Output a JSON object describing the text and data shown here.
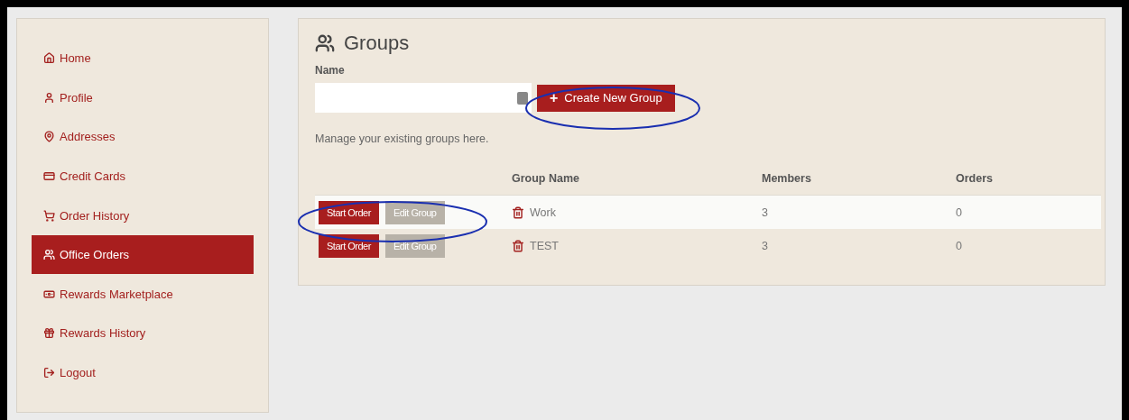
{
  "sidebar": {
    "items": [
      {
        "label": "Home",
        "selected": false
      },
      {
        "label": "Profile",
        "selected": false
      },
      {
        "label": "Addresses",
        "selected": false
      },
      {
        "label": "Credit Cards",
        "selected": false
      },
      {
        "label": "Order History",
        "selected": false
      },
      {
        "label": "Office Orders",
        "selected": true
      },
      {
        "label": "Rewards Marketplace",
        "selected": false
      },
      {
        "label": "Rewards History",
        "selected": false
      },
      {
        "label": "Logout",
        "selected": false
      }
    ]
  },
  "main": {
    "title": "Groups",
    "name_label": "Name",
    "create_button": "Create New Group",
    "create_icon": "+",
    "hint": "Manage your existing groups here.",
    "table": {
      "columns": [
        "Group Name",
        "Members",
        "Orders"
      ],
      "rows": [
        {
          "start": "Start Order",
          "edit": "Edit Group",
          "name": "Work",
          "members": "3",
          "orders": "0",
          "highlighted": true,
          "circled": true
        },
        {
          "start": "Start Order",
          "edit": "Edit Group",
          "name": "TEST",
          "members": "3",
          "orders": "0",
          "highlighted": false,
          "circled": false
        }
      ]
    }
  },
  "create_circled": true
}
